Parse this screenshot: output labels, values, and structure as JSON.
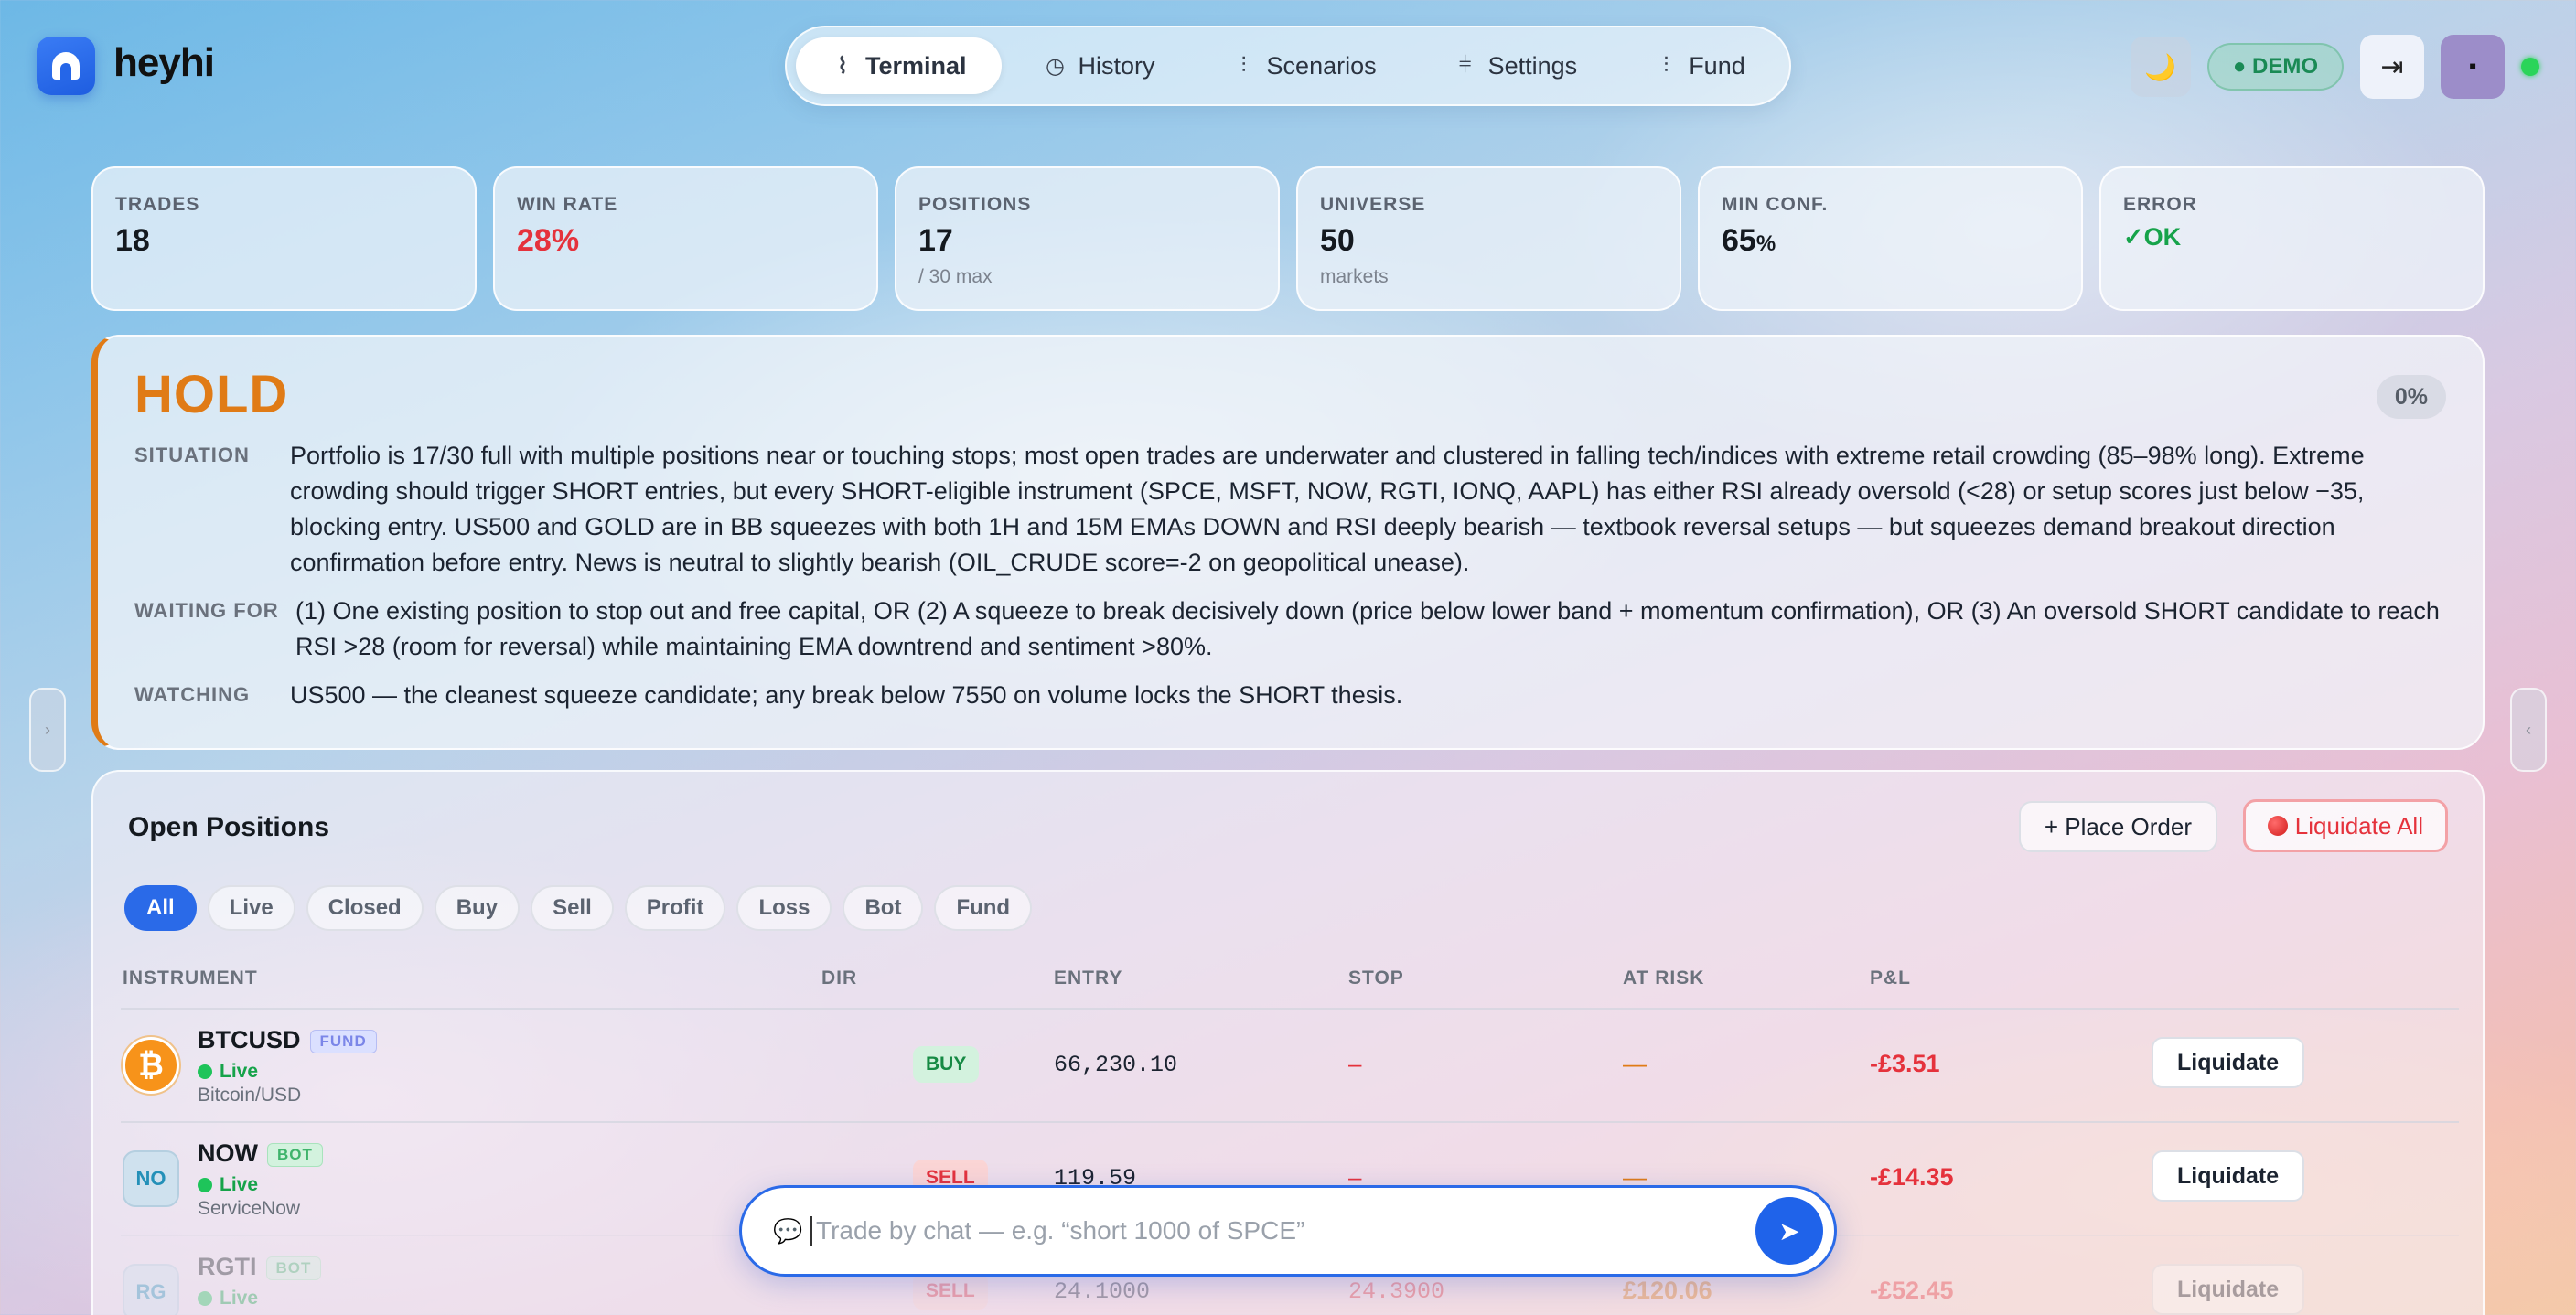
{
  "brand": {
    "name": "heyhi"
  },
  "nav": {
    "tabs": [
      {
        "label": "Terminal",
        "icon": "activity-icon",
        "active": true
      },
      {
        "label": "History",
        "icon": "clock-icon"
      },
      {
        "label": "Scenarios",
        "icon": "bar-chart-icon"
      },
      {
        "label": "Settings",
        "icon": "sliders-icon"
      },
      {
        "label": "Fund",
        "icon": "signal-icon"
      }
    ]
  },
  "header": {
    "demo_label": "● DEMO",
    "theme_icon": "🌙",
    "logout_icon": "⇥",
    "avatar_glyph": "▪"
  },
  "stats": [
    {
      "label": "TRADES",
      "value": "18",
      "sub": ""
    },
    {
      "label": "WIN RATE",
      "value": "28%",
      "sub": "",
      "color": "#e5323c"
    },
    {
      "label": "POSITIONS",
      "value": "17",
      "sub": "/ 30 max"
    },
    {
      "label": "UNIVERSE",
      "value": "50",
      "sub": "markets"
    },
    {
      "label": "MIN CONF.",
      "value": "65",
      "unit": "%",
      "sub": ""
    },
    {
      "label": "ERROR",
      "value": "✓OK",
      "sub": "",
      "color": "#16a34a"
    }
  ],
  "decision": {
    "action": "HOLD",
    "confidence": "0%",
    "situation_label": "SITUATION",
    "situation": "Portfolio is 17/30 full with multiple positions near or touching stops; most open trades are underwater and clustered in falling tech/indices with extreme retail crowding (85–98% long). Extreme crowding should trigger SHORT entries, but every SHORT-eligible instrument (SPCE, MSFT, NOW, RGTI, IONQ, AAPL) has either RSI already oversold (<28) or setup scores just below −35, blocking entry. US500 and GOLD are in BB squeezes with both 1H and 15M EMAs DOWN and RSI deeply bearish — textbook reversal setups — but squeezes demand breakout direction confirmation before entry. News is neutral to slightly bearish (OIL_CRUDE score=-2 on geopolitical unease).",
    "waiting_label": "WAITING FOR",
    "waiting": "(1) One existing position to stop out and free capital, OR (2) A squeeze to break decisively down (price below lower band + momentum confirmation), OR (3) An oversold SHORT candidate to reach RSI >28 (room for reversal) while maintaining EMA downtrend and sentiment >80%.",
    "watching_label": "WATCHING",
    "watching": "US500 — the cleanest squeeze candidate; any break below 7550 on volume locks the SHORT thesis."
  },
  "positions": {
    "title": "Open Positions",
    "place_order": "+ Place Order",
    "liquidate_all": "Liquidate All",
    "filters": [
      "All",
      "Live",
      "Closed",
      "Buy",
      "Sell",
      "Profit",
      "Loss",
      "Bot",
      "Fund"
    ],
    "active_filter": "All",
    "columns": [
      "INSTRUMENT",
      "DIR",
      "ENTRY",
      "STOP",
      "AT RISK",
      "P&L"
    ],
    "rows": [
      {
        "symbol": "BTCUSD",
        "icon": "₿",
        "tag": "FUND",
        "status": "Live",
        "name": "Bitcoin/USD",
        "dir": "BUY",
        "entry": "66,230.10",
        "stop": "–",
        "at_risk": "—",
        "pnl": "-£3.51",
        "action": "Liquidate"
      },
      {
        "symbol": "NOW",
        "icon": "NO",
        "tag": "BOT",
        "status": "Live",
        "name": "ServiceNow",
        "dir": "SELL",
        "entry": "119.59",
        "stop": "–",
        "at_risk": "—",
        "pnl": "-£14.35",
        "action": "Liquidate"
      },
      {
        "symbol": "RGTI",
        "icon": "RG",
        "tag": "BOT",
        "status": "Live",
        "name": "",
        "dir": "SELL",
        "entry": "24.1000",
        "stop": "24.3900",
        "at_risk": "£120.06",
        "pnl": "-£52.45",
        "action": "Liquidate"
      }
    ]
  },
  "chat": {
    "placeholder": "Trade by chat — e.g. “short 1000 of SPCE”",
    "icon": "chat-bubble-icon",
    "send_icon": "send-icon"
  }
}
